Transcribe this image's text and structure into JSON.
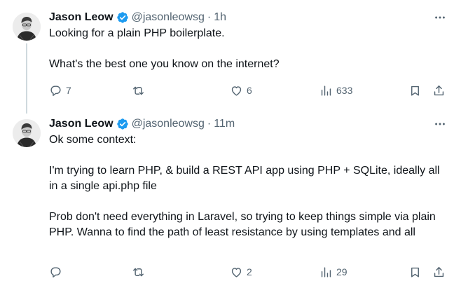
{
  "colors": {
    "text": "#0f1419",
    "secondary": "#536471",
    "verified": "#1d9bf0",
    "thread_line": "#cfd9de"
  },
  "tweets": [
    {
      "author_name": "Jason Leow",
      "handle": "@jasonleowsg",
      "separator": "·",
      "time": "1h",
      "paragraphs": [
        "Looking for a plain PHP boilerplate.",
        "What's the best one you know on the internet?"
      ],
      "replies": "7",
      "retweets": "",
      "likes": "6",
      "views": "633"
    },
    {
      "author_name": "Jason Leow",
      "handle": "@jasonleowsg",
      "separator": "·",
      "time": "11m",
      "paragraphs": [
        "Ok some context:",
        "I'm trying to learn PHP, & build a REST API app using PHP + SQLite, ideally all in a single api.php file",
        "Prob don't need everything in Laravel, so trying to keep things simple via plain PHP. Wanna to find the path of least resistance by using templates and all"
      ],
      "replies": "",
      "retweets": "",
      "likes": "2",
      "views": "29"
    }
  ],
  "icons": {
    "verified": "verified-badge-icon",
    "more": "more-horizontal-icon",
    "reply": "reply-bubble-icon",
    "retweet": "retweet-icon",
    "like": "heart-icon",
    "views": "bar-chart-icon",
    "bookmark": "bookmark-icon",
    "share": "share-icon"
  }
}
